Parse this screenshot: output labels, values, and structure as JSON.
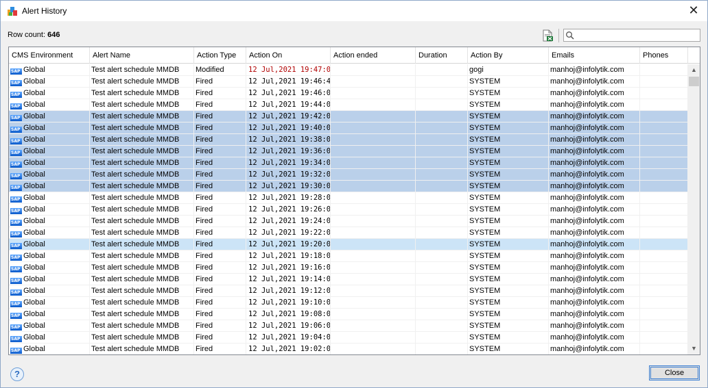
{
  "window": {
    "title": "Alert History",
    "close_glyph": "✕"
  },
  "toolbar": {
    "row_count_label": "Row count:",
    "row_count_value": "646",
    "export_icon": "excel-export-icon",
    "search_placeholder": "",
    "search_value": ""
  },
  "grid": {
    "columns": [
      "CMS Environment",
      "Alert Name",
      "Action Type",
      "Action On",
      "Action ended",
      "Duration",
      "Action By",
      "Emails",
      "Phones"
    ],
    "rows": [
      {
        "env": "Global",
        "name": "Test alert schedule MMDB",
        "type": "Modified",
        "on": "12 Jul,2021 19:47:02",
        "ended": "",
        "duration": "",
        "by": "gogi",
        "email": "manhoj@infolytik.com",
        "phones": "",
        "state": "normal",
        "highlight_on": true
      },
      {
        "env": "Global",
        "name": "Test alert schedule MMDB",
        "type": "Fired",
        "on": "12 Jul,2021 19:46:44",
        "ended": "",
        "duration": "",
        "by": "SYSTEM",
        "email": "manhoj@infolytik.com",
        "phones": "",
        "state": "normal"
      },
      {
        "env": "Global",
        "name": "Test alert schedule MMDB",
        "type": "Fired",
        "on": "12 Jul,2021 19:46:00",
        "ended": "",
        "duration": "",
        "by": "SYSTEM",
        "email": "manhoj@infolytik.com",
        "phones": "",
        "state": "normal"
      },
      {
        "env": "Global",
        "name": "Test alert schedule MMDB",
        "type": "Fired",
        "on": "12 Jul,2021 19:44:00",
        "ended": "",
        "duration": "",
        "by": "SYSTEM",
        "email": "manhoj@infolytik.com",
        "phones": "",
        "state": "normal"
      },
      {
        "env": "Global",
        "name": "Test alert schedule MMDB",
        "type": "Fired",
        "on": "12 Jul,2021 19:42:00",
        "ended": "",
        "duration": "",
        "by": "SYSTEM",
        "email": "manhoj@infolytik.com",
        "phones": "",
        "state": "selected"
      },
      {
        "env": "Global",
        "name": "Test alert schedule MMDB",
        "type": "Fired",
        "on": "12 Jul,2021 19:40:00",
        "ended": "",
        "duration": "",
        "by": "SYSTEM",
        "email": "manhoj@infolytik.com",
        "phones": "",
        "state": "selected"
      },
      {
        "env": "Global",
        "name": "Test alert schedule MMDB",
        "type": "Fired",
        "on": "12 Jul,2021 19:38:01",
        "ended": "",
        "duration": "",
        "by": "SYSTEM",
        "email": "manhoj@infolytik.com",
        "phones": "",
        "state": "selected"
      },
      {
        "env": "Global",
        "name": "Test alert schedule MMDB",
        "type": "Fired",
        "on": "12 Jul,2021 19:36:01",
        "ended": "",
        "duration": "",
        "by": "SYSTEM",
        "email": "manhoj@infolytik.com",
        "phones": "",
        "state": "selected"
      },
      {
        "env": "Global",
        "name": "Test alert schedule MMDB",
        "type": "Fired",
        "on": "12 Jul,2021 19:34:00",
        "ended": "",
        "duration": "",
        "by": "SYSTEM",
        "email": "manhoj@infolytik.com",
        "phones": "",
        "state": "selected"
      },
      {
        "env": "Global",
        "name": "Test alert schedule MMDB",
        "type": "Fired",
        "on": "12 Jul,2021 19:32:00",
        "ended": "",
        "duration": "",
        "by": "SYSTEM",
        "email": "manhoj@infolytik.com",
        "phones": "",
        "state": "selected"
      },
      {
        "env": "Global",
        "name": "Test alert schedule MMDB",
        "type": "Fired",
        "on": "12 Jul,2021 19:30:01",
        "ended": "",
        "duration": "",
        "by": "SYSTEM",
        "email": "manhoj@infolytik.com",
        "phones": "",
        "state": "selected"
      },
      {
        "env": "Global",
        "name": "Test alert schedule MMDB",
        "type": "Fired",
        "on": "12 Jul,2021 19:28:00",
        "ended": "",
        "duration": "",
        "by": "SYSTEM",
        "email": "manhoj@infolytik.com",
        "phones": "",
        "state": "normal"
      },
      {
        "env": "Global",
        "name": "Test alert schedule MMDB",
        "type": "Fired",
        "on": "12 Jul,2021 19:26:00",
        "ended": "",
        "duration": "",
        "by": "SYSTEM",
        "email": "manhoj@infolytik.com",
        "phones": "",
        "state": "normal"
      },
      {
        "env": "Global",
        "name": "Test alert schedule MMDB",
        "type": "Fired",
        "on": "12 Jul,2021 19:24:00",
        "ended": "",
        "duration": "",
        "by": "SYSTEM",
        "email": "manhoj@infolytik.com",
        "phones": "",
        "state": "normal"
      },
      {
        "env": "Global",
        "name": "Test alert schedule MMDB",
        "type": "Fired",
        "on": "12 Jul,2021 19:22:00",
        "ended": "",
        "duration": "",
        "by": "SYSTEM",
        "email": "manhoj@infolytik.com",
        "phones": "",
        "state": "normal"
      },
      {
        "env": "Global",
        "name": "Test alert schedule MMDB",
        "type": "Fired",
        "on": "12 Jul,2021 19:20:00",
        "ended": "",
        "duration": "",
        "by": "SYSTEM",
        "email": "manhoj@infolytik.com",
        "phones": "",
        "state": "hover"
      },
      {
        "env": "Global",
        "name": "Test alert schedule MMDB",
        "type": "Fired",
        "on": "12 Jul,2021 19:18:00",
        "ended": "",
        "duration": "",
        "by": "SYSTEM",
        "email": "manhoj@infolytik.com",
        "phones": "",
        "state": "normal"
      },
      {
        "env": "Global",
        "name": "Test alert schedule MMDB",
        "type": "Fired",
        "on": "12 Jul,2021 19:16:01",
        "ended": "",
        "duration": "",
        "by": "SYSTEM",
        "email": "manhoj@infolytik.com",
        "phones": "",
        "state": "normal"
      },
      {
        "env": "Global",
        "name": "Test alert schedule MMDB",
        "type": "Fired",
        "on": "12 Jul,2021 19:14:00",
        "ended": "",
        "duration": "",
        "by": "SYSTEM",
        "email": "manhoj@infolytik.com",
        "phones": "",
        "state": "normal"
      },
      {
        "env": "Global",
        "name": "Test alert schedule MMDB",
        "type": "Fired",
        "on": "12 Jul,2021 19:12:00",
        "ended": "",
        "duration": "",
        "by": "SYSTEM",
        "email": "manhoj@infolytik.com",
        "phones": "",
        "state": "normal"
      },
      {
        "env": "Global",
        "name": "Test alert schedule MMDB",
        "type": "Fired",
        "on": "12 Jul,2021 19:10:00",
        "ended": "",
        "duration": "",
        "by": "SYSTEM",
        "email": "manhoj@infolytik.com",
        "phones": "",
        "state": "normal"
      },
      {
        "env": "Global",
        "name": "Test alert schedule MMDB",
        "type": "Fired",
        "on": "12 Jul,2021 19:08:00",
        "ended": "",
        "duration": "",
        "by": "SYSTEM",
        "email": "manhoj@infolytik.com",
        "phones": "",
        "state": "normal"
      },
      {
        "env": "Global",
        "name": "Test alert schedule MMDB",
        "type": "Fired",
        "on": "12 Jul,2021 19:06:00",
        "ended": "",
        "duration": "",
        "by": "SYSTEM",
        "email": "manhoj@infolytik.com",
        "phones": "",
        "state": "normal"
      },
      {
        "env": "Global",
        "name": "Test alert schedule MMDB",
        "type": "Fired",
        "on": "12 Jul,2021 19:04:00",
        "ended": "",
        "duration": "",
        "by": "SYSTEM",
        "email": "manhoj@infolytik.com",
        "phones": "",
        "state": "normal"
      },
      {
        "env": "Global",
        "name": "Test alert schedule MMDB",
        "type": "Fired",
        "on": "12 Jul,2021 19:02:00",
        "ended": "",
        "duration": "",
        "by": "SYSTEM",
        "email": "manhoj@infolytik.com",
        "phones": "",
        "state": "normal"
      }
    ],
    "env_icon": "sap-icon",
    "env_icon_text": "SAP"
  },
  "footer": {
    "help_glyph": "?",
    "close_label": "Close"
  },
  "colors": {
    "selected_row": "#bad0ea",
    "hover_row": "#cce4f7",
    "highlight_text": "#b00000",
    "accent": "#3c7fd2"
  }
}
